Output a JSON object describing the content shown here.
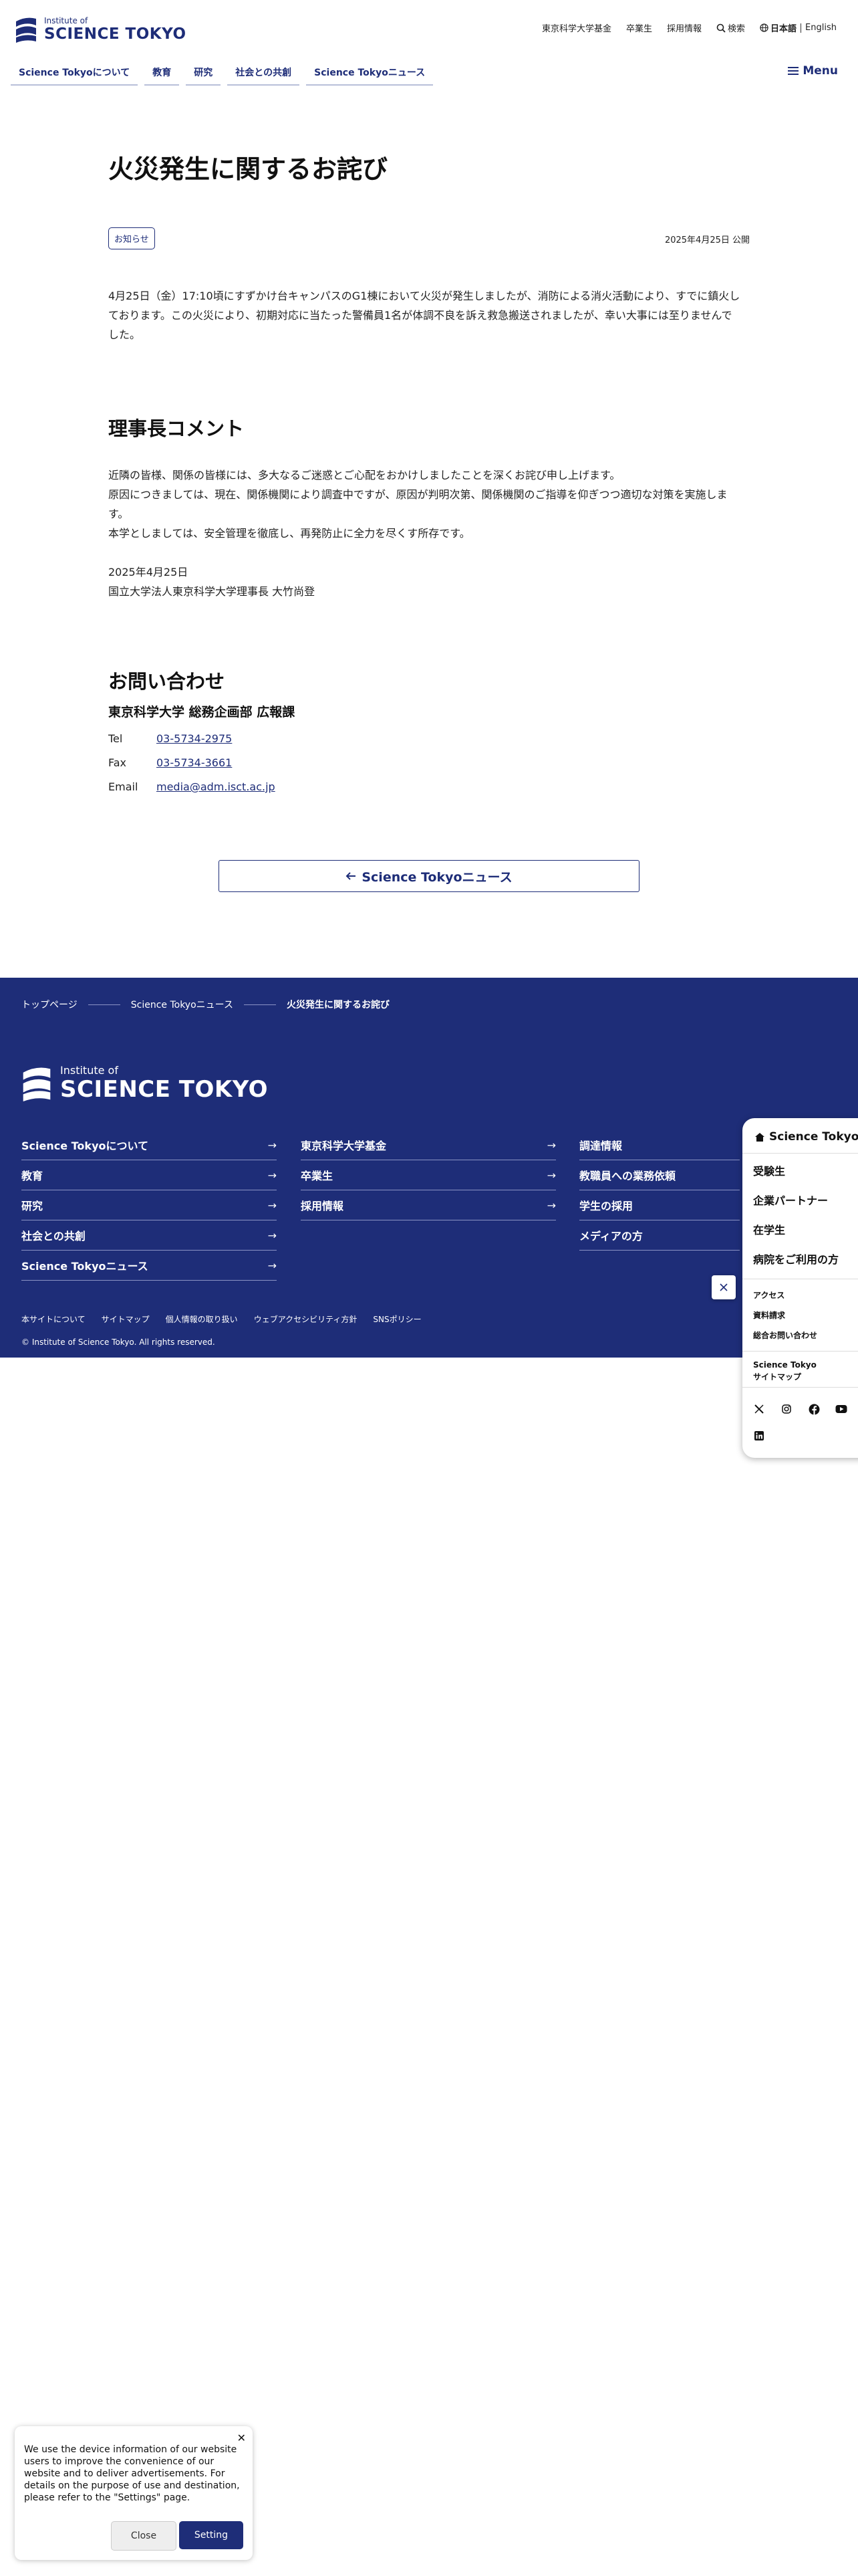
{
  "header": {
    "logo_small": "Institute of",
    "logo_big": "SCIENCE TOKYO",
    "utility": {
      "fund": "東京科学大学基金",
      "alumni": "卒業生",
      "recruit": "採用情報",
      "search": "検索",
      "lang_current": "日本語",
      "lang_other": "English"
    },
    "nav": [
      "Science Tokyoについて",
      "教育",
      "研究",
      "社会との共創",
      "Science Tokyoニュース"
    ],
    "menu": "Menu"
  },
  "article": {
    "title": "火災発生に関するお詫び",
    "tag": "お知らせ",
    "published": "2025年4月25日 公開",
    "lead": "4月25日（金）17:10頃にすずかけ台キャンパスのG1棟において火災が発生しましたが、消防による消火活動により、すでに鎮火しております。この火災により、初期対応に当たった警備員1名が体調不良を訴え救急搬送されましたが、幸い大事には至りませんでした。",
    "comment_heading": "理事長コメント",
    "comment_lines": [
      "近隣の皆様、関係の皆様には、多大なるご迷惑とご心配をおかけしましたことを深くお詫び申し上げます。",
      "原因につきましては、現在、関係機関により調査中ですが、原因が判明次第、関係機関のご指導を仰ぎつつ適切な対策を実施します。",
      "本学としましては、安全管理を徹底し、再発防止に全力を尽くす所存です。"
    ],
    "sign_date": "2025年4月25日",
    "sign_name": "国立大学法人東京科学大学理事長 大竹尚登"
  },
  "contact": {
    "heading": "お問い合わせ",
    "dept": "東京科学大学 総務企画部 広報課",
    "tel_label": "Tel",
    "tel": "03-5734-2975",
    "fax_label": "Fax",
    "fax": "03-5734-3661",
    "email_label": "Email",
    "email": "media@adm.isct.ac.jp"
  },
  "back_button": "Science Tokyoニュース",
  "footer": {
    "breadcrumb": [
      "トップページ",
      "Science Tokyoニュース",
      "火災発生に関するお詫び"
    ],
    "logo_small": "Institute of",
    "logo_big": "SCIENCE TOKYO",
    "col1": [
      "Science Tokyoについて",
      "教育",
      "研究",
      "社会との共創",
      "Science Tokyoニュース"
    ],
    "col2": [
      "東京科学大学基金",
      "卒業生",
      "採用情報"
    ],
    "col3": [
      "調達情報",
      "教職員への業務依頼",
      "学生の採用",
      "メディアの方"
    ],
    "bottom_links": [
      "本サイトについて",
      "サイトマップ",
      "個人情報の取り扱い",
      "ウェブアクセシビリティ方針",
      "SNSポリシー"
    ],
    "copyright": "© Institute of Science Tokyo. All rights reserved."
  },
  "panel": {
    "home": "Science Tokyo",
    "audiences": [
      "受験生",
      "企業パートナー",
      "在学生",
      "病院をご利用の方"
    ],
    "links": [
      "アクセス",
      "資料請求",
      "総合お問い合わせ"
    ],
    "sitemap_line1": "Science Tokyo",
    "sitemap_line2": "サイトマップ"
  },
  "cookie": {
    "text": "We use the device information of our website users to improve the convenience of our website and to deliver advertisements. For details on the purpose of use and destination, please refer to the \"Settings\" page.",
    "close": "Close",
    "setting": "Setting"
  },
  "colors": {
    "brand": "#1e2d78",
    "text": "#222222"
  }
}
